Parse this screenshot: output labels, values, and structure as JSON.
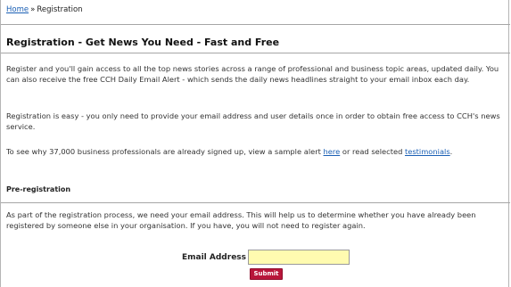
{
  "breadcrumb": {
    "home": "Home",
    "separator": "»",
    "current": "Registration"
  },
  "page_title": "Registration - Get News You Need - Fast and Free",
  "intro": "Register and you'll gain access to all the top news stories across a range of professional and business topic areas, updated daily. You can also receive the free CCH Daily Email Alert - which sends the daily news headlines straight to your email inbox each day.",
  "easy_text": "Registration is easy - you only need to provide your email address and user details once in order to obtain free access to CCH's news service.",
  "signup": {
    "prefix": "To see why 37,000 business professionals are already signed up, view a sample alert ",
    "link1": "here",
    "middle": " or read selected ",
    "link2": "testimonials",
    "suffix": "."
  },
  "preregistration": {
    "heading": "Pre-registration",
    "text": "As part of the registration process, we need your email address. This will help us to determine whether you have already been registered by someone else in your organisation. If you have, you will not need to register again."
  },
  "form": {
    "email_label": "Email Address",
    "email_value": "",
    "submit_label": "Submit"
  },
  "colors": {
    "link": "#1a5fb4",
    "submit_bg": "#b8163a",
    "input_bg": "#fffbb0"
  }
}
